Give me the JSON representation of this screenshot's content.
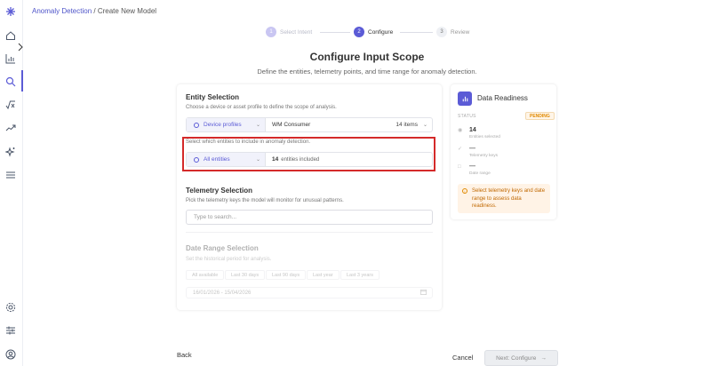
{
  "breadcrumb": {
    "link": "Anomaly Detection",
    "separator": " / ",
    "current": "Create New Model"
  },
  "steps": [
    {
      "num": "1",
      "label": "Select Intent",
      "state": "done"
    },
    {
      "num": "2",
      "label": "Configure",
      "state": "active"
    },
    {
      "num": "3",
      "label": "Review",
      "state": "pending"
    }
  ],
  "page": {
    "title": "Configure Input Scope",
    "subtitle": "Define the entities, telemetry points, and time range for anomaly detection."
  },
  "entity": {
    "title": "Entity Selection",
    "desc": "Choose a device or asset profile to define the scope of analysis.",
    "profile_type": "Device profiles",
    "profile_value": "WM Consumer",
    "profile_count": "14 items",
    "filter_desc": "Select which entities to include in anomaly detection.",
    "filter_mode": "All entities",
    "included_count": "14",
    "included_label": "entities included"
  },
  "telemetry": {
    "title": "Telemetry Selection",
    "desc": "Pick the telemetry keys the model will monitor for unusual patterns.",
    "search_placeholder": "Type to search..."
  },
  "daterange": {
    "title": "Date Range Selection",
    "desc": "Set the historical period for analysis.",
    "chips": [
      "All available",
      "Last 30 days",
      "Last 90 days",
      "Last year",
      "Last 3 years"
    ],
    "range": "16/01/2026 - 15/04/2026"
  },
  "readiness": {
    "title": "Data Readiness",
    "status_label": "STATUS",
    "status_value": "PENDING",
    "rows": [
      {
        "value": "14",
        "label": "Entities selected"
      },
      {
        "value": "—",
        "label": "Telemetry keys"
      },
      {
        "value": "—",
        "label": "Date range"
      }
    ],
    "alert": "Select telemetry keys and date range to assess data readiness."
  },
  "footer": {
    "back": "Back",
    "cancel": "Cancel",
    "next": "Next: Configure"
  },
  "colors": {
    "accent": "#5b5bd6",
    "highlight": "#d42a2a",
    "pending": "#e08a00"
  }
}
